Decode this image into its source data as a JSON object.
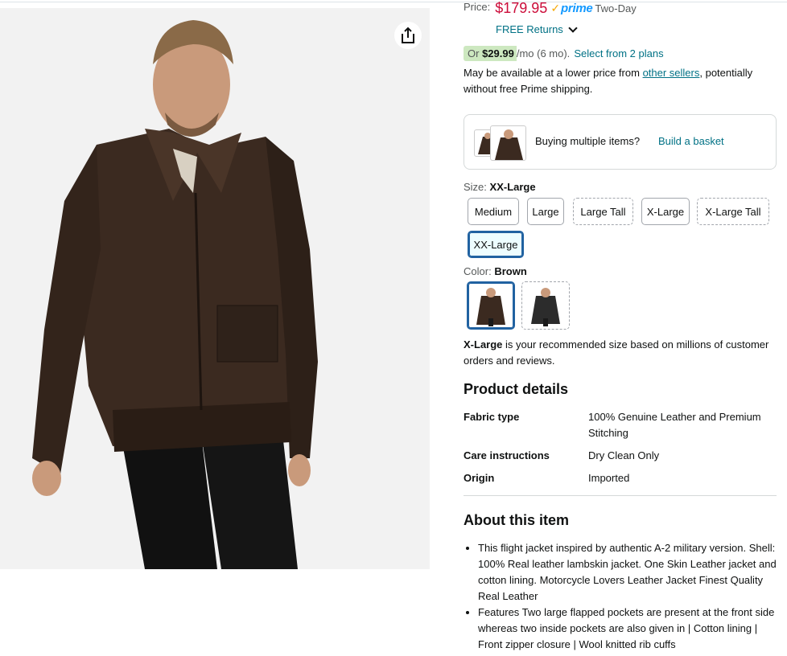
{
  "price": {
    "label": "Price:",
    "value": "$179.95",
    "prime_word": "prime",
    "prime_delivery": "Two-Day",
    "returns": "FREE Returns"
  },
  "monthly": {
    "or": "Or",
    "amount": "$29.99",
    "term": "/mo (6 mo).",
    "plans_link": "Select from 2 plans"
  },
  "lower_price": {
    "pre": "May be available at a lower price from",
    "link": "other sellers",
    "post": ", potentially without free Prime shipping."
  },
  "basket": {
    "text": "Buying multiple items?",
    "link": "Build a basket"
  },
  "size": {
    "label": "Size:",
    "selected": "XX-Large",
    "options": [
      "Medium",
      "Large",
      "Large Tall",
      "X-Large",
      "X-Large Tall",
      "XX-Large"
    ]
  },
  "color": {
    "label": "Color:",
    "selected": "Brown"
  },
  "recommendation": {
    "size": "X-Large",
    "text": " is your recommended size based on millions of customer orders and reviews."
  },
  "product_details": {
    "heading": "Product details",
    "rows": [
      {
        "key": "Fabric type",
        "value": "100% Genuine Leather and Premium Stitching"
      },
      {
        "key": "Care instructions",
        "value": "Dry Clean Only"
      },
      {
        "key": "Origin",
        "value": "Imported"
      }
    ]
  },
  "about": {
    "heading": "About this item",
    "bullets": [
      "This flight jacket inspired by authentic A-2 military version. Shell: 100% Real leather lambskin jacket. One Skin Leather jacket and cotton lining. Motorcycle Lovers Leather Jacket Finest Quality Real Leather",
      "Features Two large flapped pockets are present at the front side whereas two inside pockets are also given in | Cotton lining | Front zipper closure | Wool knitted rib cuffs"
    ]
  },
  "colors": {
    "price_red": "#cc0c39",
    "link_teal": "#007185",
    "prime_blue": "#1399ff",
    "selected_blue": "#2162a1",
    "jacket_brown": "#3b2a20"
  }
}
